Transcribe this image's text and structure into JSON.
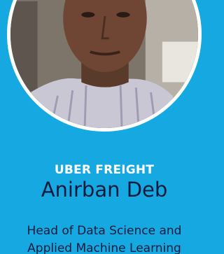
{
  "speaker": {
    "company": "UBER FREIGHT",
    "name": "Anirban Deb",
    "role_line1": "Head of Data Science and",
    "role_line2": "Applied Machine Learning"
  },
  "colors": {
    "background": "#16a8e0",
    "company_text": "#ffffff",
    "name_text": "#0e1b3d",
    "photo_border": "#ffffff"
  }
}
